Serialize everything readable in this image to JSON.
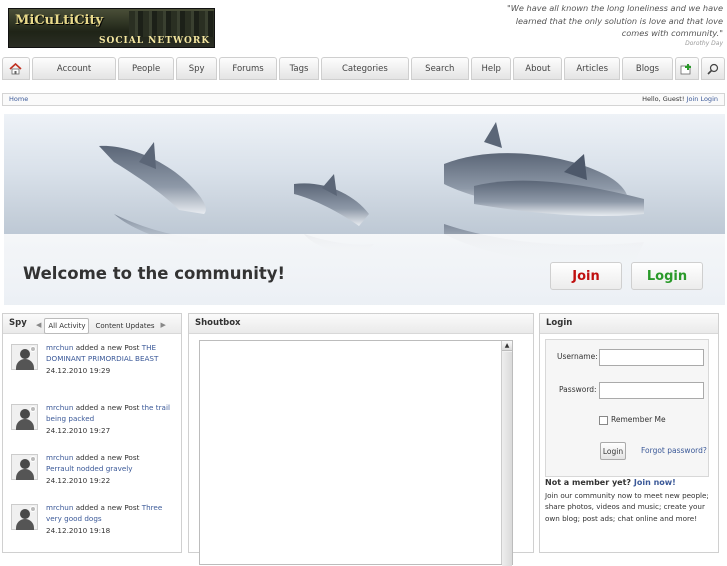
{
  "header": {
    "logo_line1": "MiCuLtiCity",
    "logo_line2": "SOCIAL NETWORK",
    "quote": "\"We have all known the long loneliness and we have learned that the only solution is love and that love comes with community.\"",
    "quote_author": "Dorothy Day"
  },
  "nav": {
    "home_icon": "home-icon",
    "items": [
      "Account",
      "People",
      "Spy",
      "Forums",
      "Tags",
      "Categories",
      "Search",
      "Help",
      "About",
      "Articles",
      "Blogs"
    ],
    "add_icon": "add-window-icon",
    "search_icon": "search-icon"
  },
  "breadcrumb": {
    "home": "Home",
    "greeting": "Hello, Guest!",
    "join": "Join",
    "login": "Login"
  },
  "banner": {
    "welcome": "Welcome to the community!",
    "join_button": "Join",
    "login_button": "Login",
    "colors": {
      "join": "#c01010",
      "login": "#2a9a2a"
    }
  },
  "spy": {
    "title": "Spy",
    "tabs": [
      "All Activity",
      "Content Updates"
    ],
    "items": [
      {
        "user": "mrchun",
        "action": "added a new Post",
        "post": "THE DOMINANT PRIMORDIAL BEAST",
        "time": "24.12.2010 19:29"
      },
      {
        "user": "mrchun",
        "action": "added a new Post",
        "post": "the trail being packed",
        "time": "24.12.2010 19:27"
      },
      {
        "user": "mrchun",
        "action": "added a new Post",
        "post": "Perrault nodded gravely",
        "time": "24.12.2010 19:22"
      },
      {
        "user": "mrchun",
        "action": "added a new Post",
        "post": "Three very good dogs",
        "time": "24.12.2010 19:18"
      }
    ]
  },
  "shoutbox": {
    "title": "Shoutbox"
  },
  "login": {
    "title": "Login",
    "username_label": "Username:",
    "password_label": "Password:",
    "remember_label": "Remember Me",
    "login_button": "Login",
    "forgot": "Forgot password?",
    "not_member": "Not a member yet?",
    "join_now": "Join now!",
    "description": "Join our community now to meet new people; share photos, videos and music; create your own blog; post ads; chat online and more!"
  }
}
